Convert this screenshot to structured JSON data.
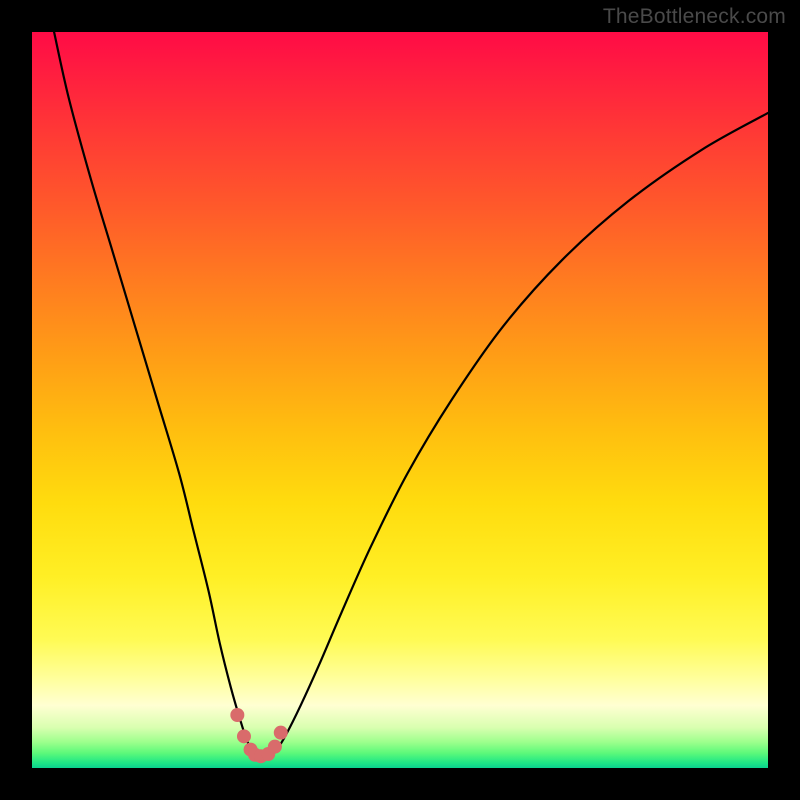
{
  "watermark": "TheBottleneck.com",
  "chart_data": {
    "type": "line",
    "title": "",
    "xlabel": "",
    "ylabel": "",
    "xlim": [
      0,
      100
    ],
    "ylim": [
      0,
      100
    ],
    "series": [
      {
        "name": "bottleneck-curve",
        "x": [
          3,
          5,
          8,
          11,
          14,
          17,
          20,
          22,
          24,
          25.5,
          27,
          28.3,
          29.3,
          30.3,
          31.3,
          32.3,
          33.2,
          34.5,
          36.5,
          39,
          42,
          46,
          51,
          57,
          64,
          72,
          81,
          91,
          100
        ],
        "values": [
          100,
          91,
          80,
          70,
          60,
          50,
          40,
          32,
          24,
          17,
          11,
          6.5,
          3.5,
          1.8,
          1.3,
          1.5,
          2.4,
          4.5,
          8.5,
          14,
          21,
          30,
          40,
          50,
          60,
          69,
          77,
          84,
          89
        ]
      }
    ],
    "markers": {
      "name": "highlight-points",
      "color": "#d96b6b",
      "x": [
        27.9,
        28.8,
        29.7,
        30.3,
        31.1,
        32.1,
        33.0,
        33.8
      ],
      "values": [
        7.2,
        4.3,
        2.5,
        1.8,
        1.6,
        1.9,
        2.9,
        4.8
      ]
    },
    "background_gradient": {
      "top_color": "#ff0b46",
      "mid_color": "#ffdc0e",
      "bottom_color": "#0bd28f"
    }
  }
}
